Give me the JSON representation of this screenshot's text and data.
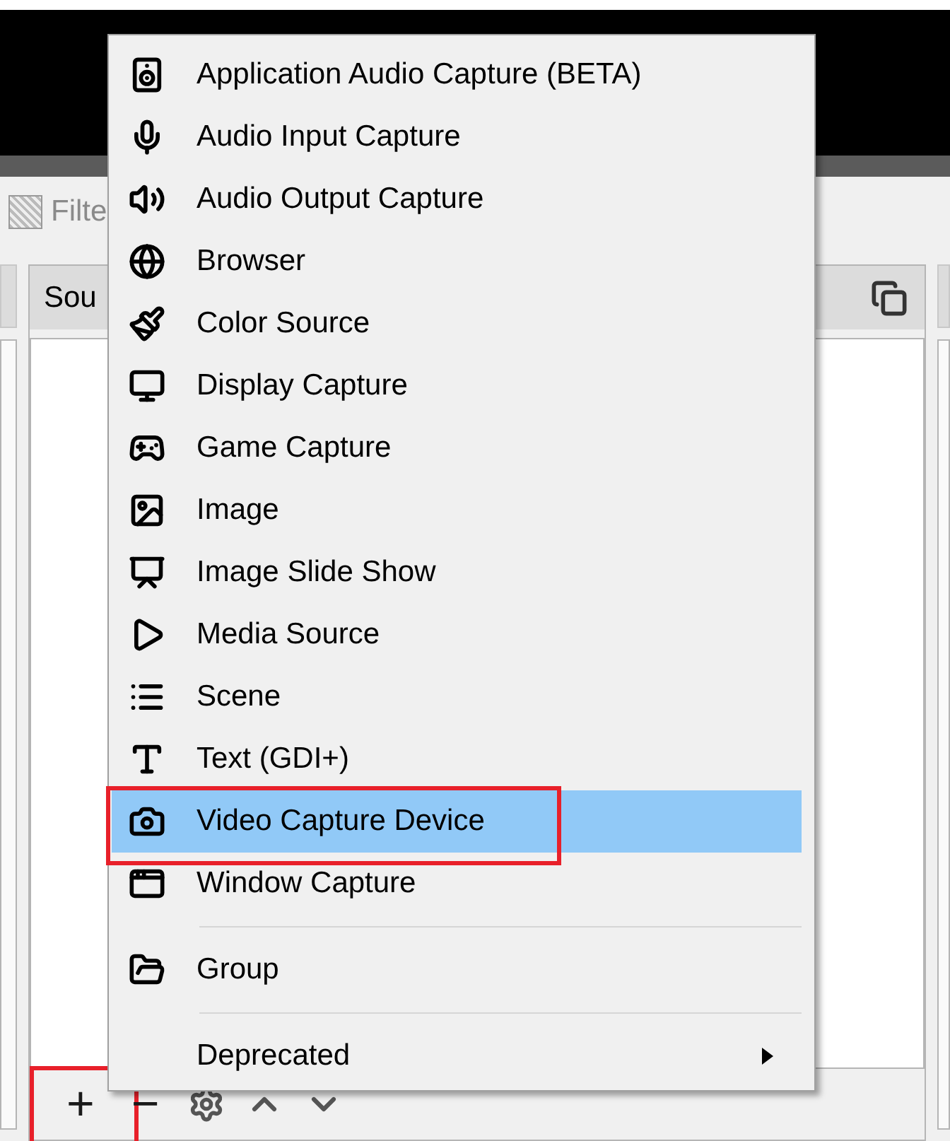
{
  "filter": {
    "label": "Filte"
  },
  "sources_dock": {
    "title": "Sou",
    "toolbar": [
      {
        "label": "+",
        "annotated": true
      },
      {
        "label": "−",
        "annotated": false
      }
    ]
  },
  "menu": {
    "sections": [
      {
        "items": [
          {
            "label": "Application Audio Capture (BETA)",
            "selected": false,
            "annotated": false,
            "submenu": false
          },
          {
            "label": "Audio Input Capture",
            "selected": false,
            "annotated": false,
            "submenu": false
          },
          {
            "label": "Audio Output Capture",
            "selected": false,
            "annotated": false,
            "submenu": false
          },
          {
            "label": "Browser",
            "selected": false,
            "annotated": false,
            "submenu": false
          },
          {
            "label": "Color Source",
            "selected": false,
            "annotated": false,
            "submenu": false
          },
          {
            "label": "Display Capture",
            "selected": false,
            "annotated": false,
            "submenu": false
          },
          {
            "label": "Game Capture",
            "selected": false,
            "annotated": false,
            "submenu": false
          },
          {
            "label": "Image",
            "selected": false,
            "annotated": false,
            "submenu": false
          },
          {
            "label": "Image Slide Show",
            "selected": false,
            "annotated": false,
            "submenu": false
          },
          {
            "label": "Media Source",
            "selected": false,
            "annotated": false,
            "submenu": false
          },
          {
            "label": "Scene",
            "selected": false,
            "annotated": false,
            "submenu": false
          },
          {
            "label": "Text (GDI+)",
            "selected": false,
            "annotated": false,
            "submenu": false
          },
          {
            "label": "Video Capture Device",
            "selected": true,
            "annotated": true,
            "submenu": false
          },
          {
            "label": "Window Capture",
            "selected": false,
            "annotated": false,
            "submenu": false
          }
        ]
      },
      {
        "items": [
          {
            "label": "Group",
            "selected": false,
            "annotated": false,
            "submenu": false
          }
        ]
      },
      {
        "items": [
          {
            "label": "Deprecated",
            "selected": false,
            "annotated": false,
            "submenu": true
          }
        ]
      }
    ]
  }
}
